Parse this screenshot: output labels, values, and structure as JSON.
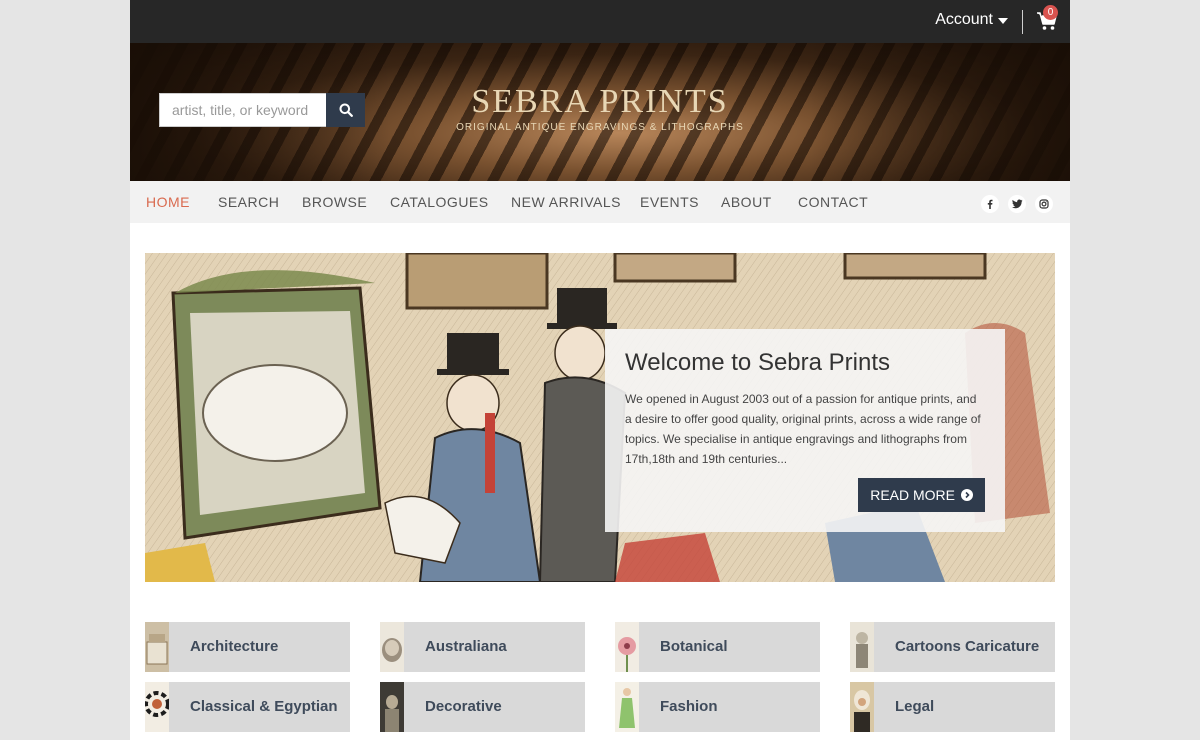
{
  "topbar": {
    "account_label": "Account",
    "cart_count": "0"
  },
  "banner": {
    "search_placeholder": "artist, title, or keyword",
    "logo_title": "SEBRA PRINTS",
    "logo_subtitle": "ORIGINAL ANTIQUE ENGRAVINGS & LITHOGRAPHS"
  },
  "nav": {
    "items": [
      "HOME",
      "SEARCH",
      "BROWSE",
      "CATALOGUES",
      "NEW ARRIVALS",
      "EVENTS",
      "ABOUT",
      "CONTACT"
    ],
    "active": "HOME",
    "social": [
      "facebook-icon",
      "twitter-icon",
      "instagram-icon"
    ]
  },
  "hero": {
    "title": "Welcome to Sebra Prints",
    "text": "We opened in August 2003 out of a passion for antique prints, and a desire to offer good quality, original prints, across a wide range of topics. We specialise in antique engravings and lithographs from 17th,18th and 19th centuries...",
    "button": "READ MORE"
  },
  "categories": [
    "Architecture",
    "Australiana",
    "Botanical",
    "Cartoons Caricature",
    "Classical & Egyptian",
    "Decorative",
    "Fashion",
    "Legal"
  ],
  "colors": {
    "topbar": "#272727",
    "accent_nav": "#d96a4f",
    "button": "#2f3b4c",
    "category_bg": "#d9d9d9",
    "category_text": "#3f4b5b"
  }
}
